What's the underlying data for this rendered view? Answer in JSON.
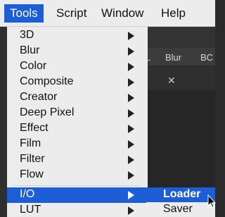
{
  "menubar": {
    "tools": "Tools",
    "script": "Script",
    "window": "Window",
    "help": "Help"
  },
  "tools_menu": {
    "items": [
      {
        "label": "3D"
      },
      {
        "label": "Blur"
      },
      {
        "label": "Color"
      },
      {
        "label": "Composite"
      },
      {
        "label": "Creator"
      },
      {
        "label": "Deep Pixel"
      },
      {
        "label": "Effect"
      },
      {
        "label": "Film"
      },
      {
        "label": "Filter"
      },
      {
        "label": "Flow"
      },
      {
        "label": "I/O",
        "highlighted": true
      },
      {
        "label": "LUT"
      }
    ]
  },
  "io_submenu": {
    "items": [
      {
        "label": "Loader",
        "highlighted": true
      },
      {
        "label": "Saver"
      }
    ]
  },
  "background": {
    "tab_partial": "L",
    "tab_blur": "Blur",
    "tab_bc": "BC",
    "close_glyph": "✕"
  },
  "colors": {
    "highlight": "#1d5dd6",
    "menu_bg": "#ececec"
  }
}
